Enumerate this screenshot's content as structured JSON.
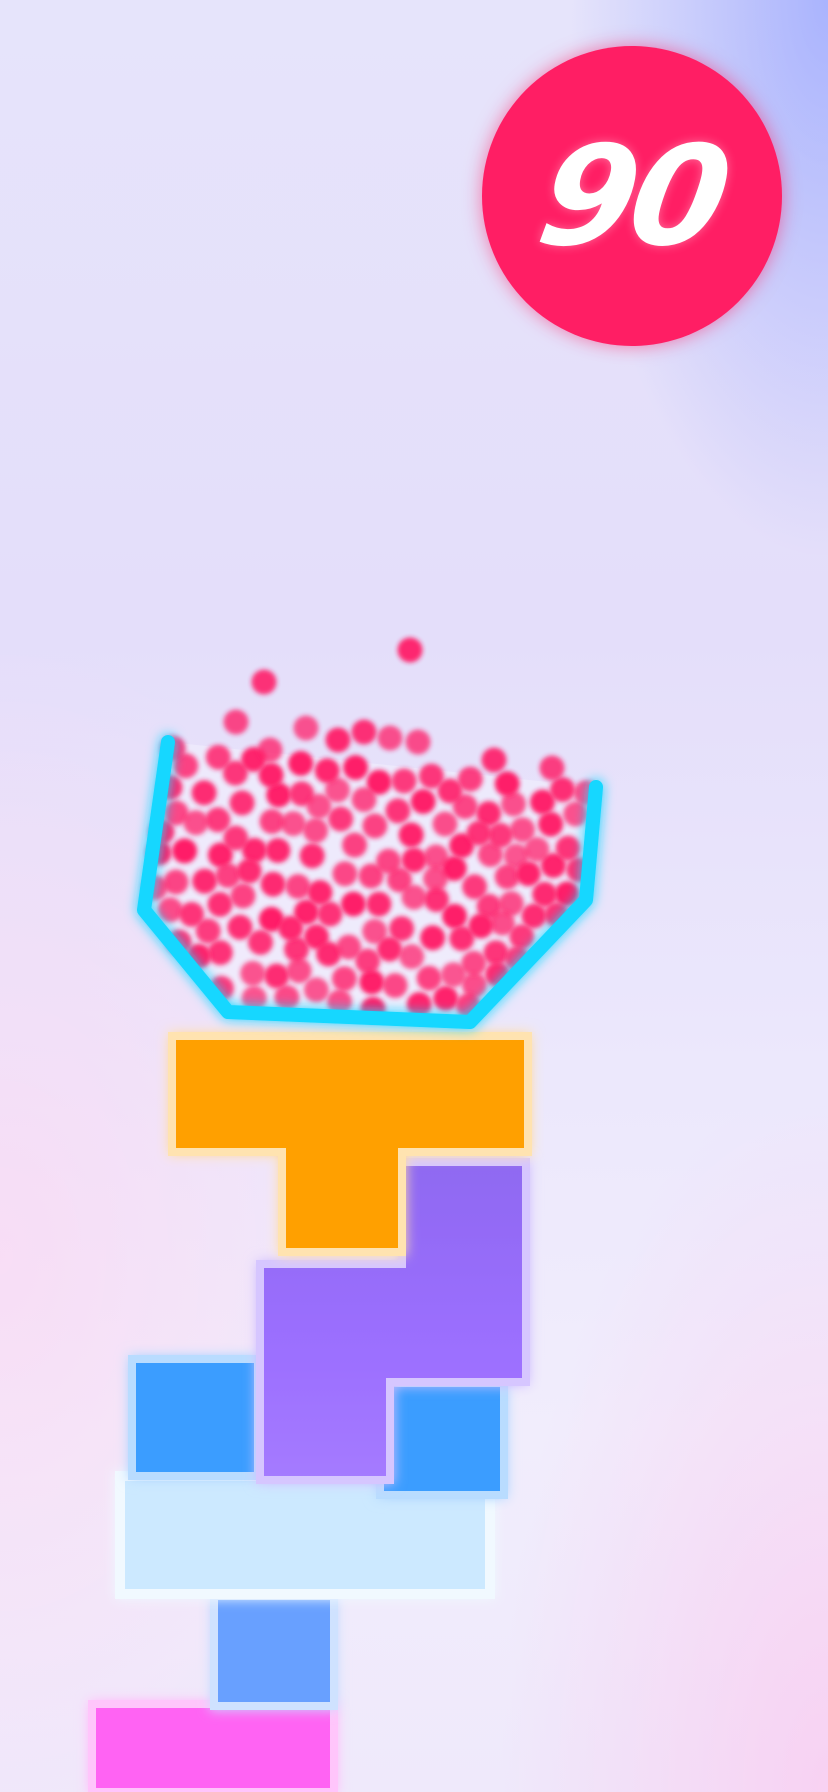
{
  "hud": {
    "score": "90"
  },
  "colors": {
    "score_badge": "#ff1e64",
    "ball": "#ff1f67",
    "cup_outline": "#12d7ff",
    "block_orange": "#ffa000",
    "block_purple": "#9b6dff",
    "block_blue": "#3aa0ff",
    "block_light": "#cce9ff",
    "block_blue_small": "#68a0ff",
    "block_pink": "#ff64f3"
  },
  "scene": {
    "cup_icon": "cup-icon",
    "blocks": [
      {
        "name": "orange-t-block",
        "color_key": "block_orange"
      },
      {
        "name": "purple-s-block",
        "color_key": "block_purple"
      },
      {
        "name": "blue-square-block-left",
        "color_key": "block_blue"
      },
      {
        "name": "blue-square-block-right",
        "color_key": "block_blue"
      },
      {
        "name": "light-blue-plank-block",
        "color_key": "block_light"
      },
      {
        "name": "blue-small-square-block",
        "color_key": "block_blue_small"
      },
      {
        "name": "pink-block",
        "color_key": "block_pink"
      }
    ]
  }
}
